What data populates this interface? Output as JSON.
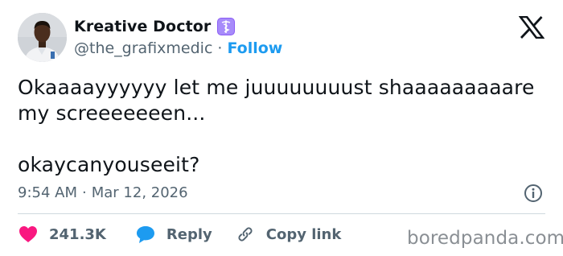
{
  "author": {
    "display_name": "Kreative Doctor",
    "badge_icon": "medical-caduceus-icon",
    "handle": "@the_grafixmedic",
    "separator": "·",
    "follow_label": "Follow"
  },
  "platform_icon": "x-logo-icon",
  "tweet": {
    "lines": [
      "Okaaaayyyyyy let me juuuuuuuust shaaaaaaaaare",
      "my screeeeeeen...",
      "okaycanyouseeit?"
    ]
  },
  "meta": {
    "time": "9:54 AM",
    "separator": "·",
    "date": "Mar 12, 2026",
    "info_icon": "info-icon"
  },
  "actions": {
    "likes_count": "241.3K",
    "reply_label": "Reply",
    "copy_link_label": "Copy link"
  },
  "watermark": "boredpanda.com",
  "colors": {
    "like": "#f91880",
    "reply": "#1d9bf0",
    "follow": "#1d9bf0",
    "muted": "#536471",
    "badge": "#a78bfa"
  }
}
